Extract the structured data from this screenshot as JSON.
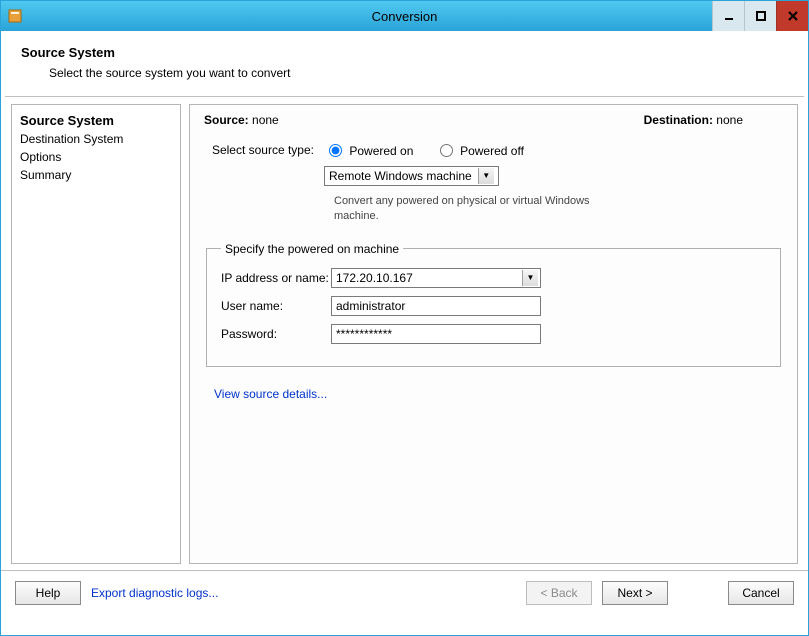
{
  "window": {
    "title": "Conversion",
    "controls": {
      "min": "minimize",
      "max": "maximize",
      "close": "close"
    }
  },
  "header": {
    "heading": "Source System",
    "subheading": "Select the source system you want to convert"
  },
  "sidebar": {
    "steps": [
      {
        "label": "Source System",
        "active": true
      },
      {
        "label": "Destination System",
        "active": false
      },
      {
        "label": "Options",
        "active": false
      },
      {
        "label": "Summary",
        "active": false
      }
    ]
  },
  "main": {
    "source_label": "Source:",
    "source_value": "none",
    "destination_label": "Destination:",
    "destination_value": "none",
    "select_source_type_label": "Select source type:",
    "radio_powered_on": "Powered on",
    "radio_powered_off": "Powered off",
    "radio_selected": "on",
    "machine_type_combo": "Remote Windows machine",
    "machine_type_hint": "Convert any powered on physical or virtual Windows machine.",
    "group_legend": "Specify the powered on machine",
    "ip_label": "IP address or name:",
    "ip_value": "172.20.10.167",
    "user_label": "User name:",
    "user_value": "administrator",
    "password_label": "Password:",
    "password_value": "************",
    "view_details_link": "View source details..."
  },
  "footer": {
    "help": "Help",
    "export_logs": "Export diagnostic logs...",
    "back": "< Back",
    "next": "Next >",
    "cancel": "Cancel",
    "back_enabled": false
  }
}
